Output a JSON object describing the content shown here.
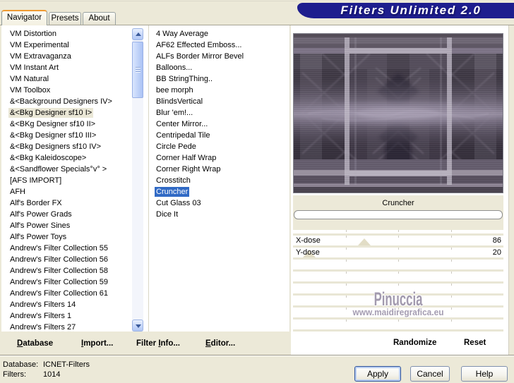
{
  "banner": {
    "title": "Filters Unlimited 2.0"
  },
  "tabs": [
    {
      "label": "Navigator",
      "active": true
    },
    {
      "label": "Presets",
      "active": false
    },
    {
      "label": "About",
      "active": false
    }
  ],
  "categories": {
    "items": [
      "VM Distortion",
      "VM Experimental",
      "VM Extravaganza",
      "VM Instant Art",
      "VM Natural",
      "VM Toolbox",
      "&<Background Designers IV>",
      "&<Bkg Designer sf10 I>",
      "&<BKg Designer sf10 II>",
      "&<Bkg Designer sf10 III>",
      "&<Bkg Designers sf10 IV>",
      "&<Bkg Kaleidoscope>",
      "&<Sandflower Specials°v° >",
      "[AFS IMPORT]",
      "AFH",
      "Alf's Border FX",
      "Alf's Power Grads",
      "Alf's Power Sines",
      "Alf's Power Toys",
      "Andrew's Filter Collection 55",
      "Andrew's Filter Collection 56",
      "Andrew's Filter Collection 58",
      "Andrew's Filter Collection 59",
      "Andrew's Filter Collection 61",
      "Andrew's Filters 14",
      "Andrew's Filters 1",
      "Andrew's Filters 27"
    ],
    "selected_index": 7
  },
  "filters": {
    "items": [
      "4 Way Average",
      "AF62 Effected Emboss...",
      "ALFs Border Mirror Bevel",
      "Balloons...",
      "BB StringThing..",
      "bee morph",
      "BlindsVertical",
      "Blur 'em!...",
      "Center Mirror...",
      "Centripedal Tile",
      "Circle Pede",
      "Corner Half Wrap",
      "Corner Right Wrap",
      "Crosstitch",
      "Cruncher",
      "Cut Glass 03",
      "Dice It"
    ],
    "selected_index": 14
  },
  "preview": {
    "caption": "Cruncher"
  },
  "parameters": {
    "rows": [
      {
        "label": "X-dose",
        "value": 86
      },
      {
        "label": "Y-dose",
        "value": 20
      }
    ],
    "empty_rows": 6
  },
  "watermark": {
    "name": "Pinuccia",
    "url_text": "www.maidiregrafica.eu"
  },
  "toolbar": [
    {
      "label": "Database",
      "underline": 0
    },
    {
      "label": "Import...",
      "underline": 0
    },
    {
      "label": "Filter Info...",
      "underline": 7
    },
    {
      "label": "Editor...",
      "underline": 0
    }
  ],
  "panel_actions": {
    "randomize": "Randomize",
    "reset": "Reset"
  },
  "status": [
    {
      "label": "Database:",
      "value": "ICNET-Filters"
    },
    {
      "label": "Filters:",
      "value": "1014"
    }
  ],
  "buttons": [
    {
      "label": "Apply",
      "focused": true
    },
    {
      "label": "Cancel",
      "focused": false
    },
    {
      "label": "Help",
      "focused": false
    }
  ],
  "colors": {
    "selection": "#316ac5",
    "banner": "#1e1e8e",
    "face": "#ece9d8"
  }
}
